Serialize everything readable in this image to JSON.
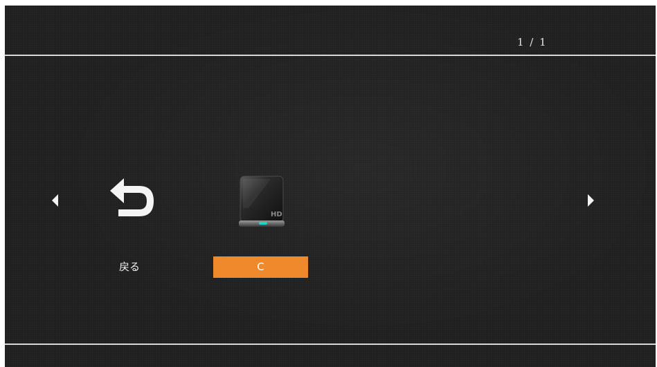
{
  "header": {
    "page_counter": "1 / 1"
  },
  "navigation": {
    "prev_icon": "triangle-left-icon",
    "next_icon": "triangle-right-icon"
  },
  "items": [
    {
      "label": "戻る",
      "icon": "return-arrow-icon",
      "selected": false
    },
    {
      "label": "C",
      "icon": "hard-drive-icon",
      "icon_badge": "HD",
      "selected": true
    }
  ],
  "colors": {
    "background": "#1f1f1f",
    "divider": "#d9d9d9",
    "selection": "#ee8a2b",
    "text": "#f2f2f2",
    "drive_led": "#1fd4c7"
  }
}
